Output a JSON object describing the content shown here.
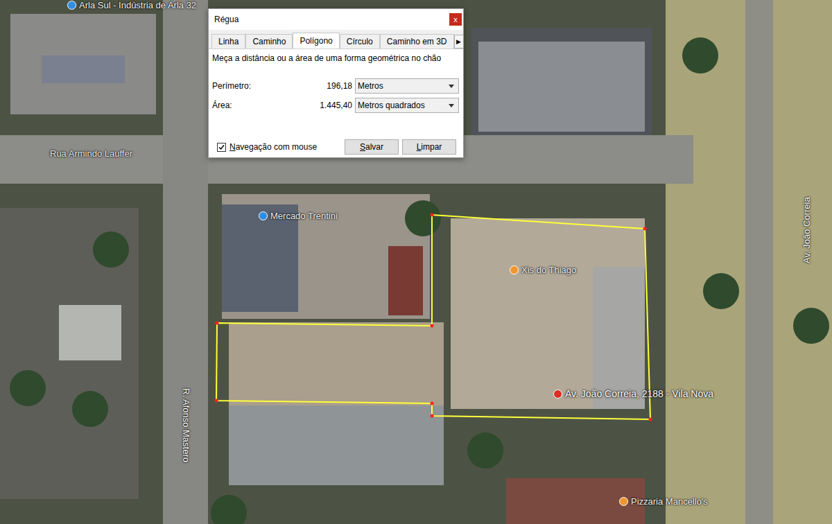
{
  "dialog": {
    "title": "Régua",
    "close": "x",
    "tabs": [
      {
        "label": "Linha",
        "selected": false
      },
      {
        "label": "Caminho",
        "selected": false
      },
      {
        "label": "Polígono",
        "selected": true
      },
      {
        "label": "Círculo",
        "selected": false
      },
      {
        "label": "Caminho em 3D",
        "selected": false
      }
    ],
    "tab_scroll": "▶",
    "description": "Meça a distância ou a área de uma forma geométrica no chão",
    "measurements": [
      {
        "label": "Perímetro:",
        "value": "196,18",
        "unit": "Metros"
      },
      {
        "label": "Área:",
        "value": "1.445,40",
        "unit": "Metros quadrados"
      }
    ],
    "mouse_navigation": {
      "label": "Navegação com mouse",
      "checked": true
    },
    "buttons": [
      "Salvar",
      "Limpar"
    ]
  },
  "map": {
    "labels": [
      {
        "text": "Arla Sul - Indústria de Arla 32",
        "kind": "place"
      },
      {
        "text": "Rua Armindo Lauffer",
        "kind": "street"
      },
      {
        "text": "Mercado Trentini",
        "kind": "place"
      },
      {
        "text": "Xis do Thiago",
        "kind": "food"
      },
      {
        "text": "Av. João Correia, 2188 - Vila Nova",
        "kind": "address"
      },
      {
        "text": "R. Afonso Mastero",
        "kind": "street-down"
      },
      {
        "text": "Av. João Correia",
        "kind": "street-up"
      },
      {
        "text": "Pizzaria Mancello's",
        "kind": "food"
      }
    ]
  }
}
